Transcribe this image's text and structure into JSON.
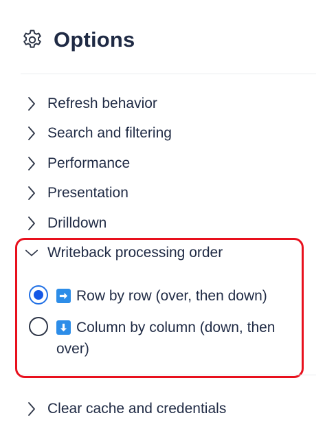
{
  "header": {
    "title": "Options",
    "icon": "gear-icon"
  },
  "sections": [
    {
      "label": "Refresh behavior",
      "expanded": false
    },
    {
      "label": "Search and filtering",
      "expanded": false
    },
    {
      "label": "Performance",
      "expanded": false
    },
    {
      "label": "Presentation",
      "expanded": false
    },
    {
      "label": "Drilldown",
      "expanded": false
    },
    {
      "label": "Writeback processing order",
      "expanded": true
    },
    {
      "label": "Clear cache and credentials",
      "expanded": false
    }
  ],
  "writeback": {
    "options": [
      {
        "label": "Row by row (over, then down)",
        "icon": "right-arrow-emoji-icon",
        "selected": true
      },
      {
        "label": "Column by column (down, then over)",
        "icon": "down-arrow-emoji-icon",
        "selected": false
      }
    ]
  },
  "colors": {
    "text": "#1f2a44",
    "accent": "#1558e6",
    "highlight_border": "#e8101d",
    "emoji_blue": "#2d8de8"
  }
}
